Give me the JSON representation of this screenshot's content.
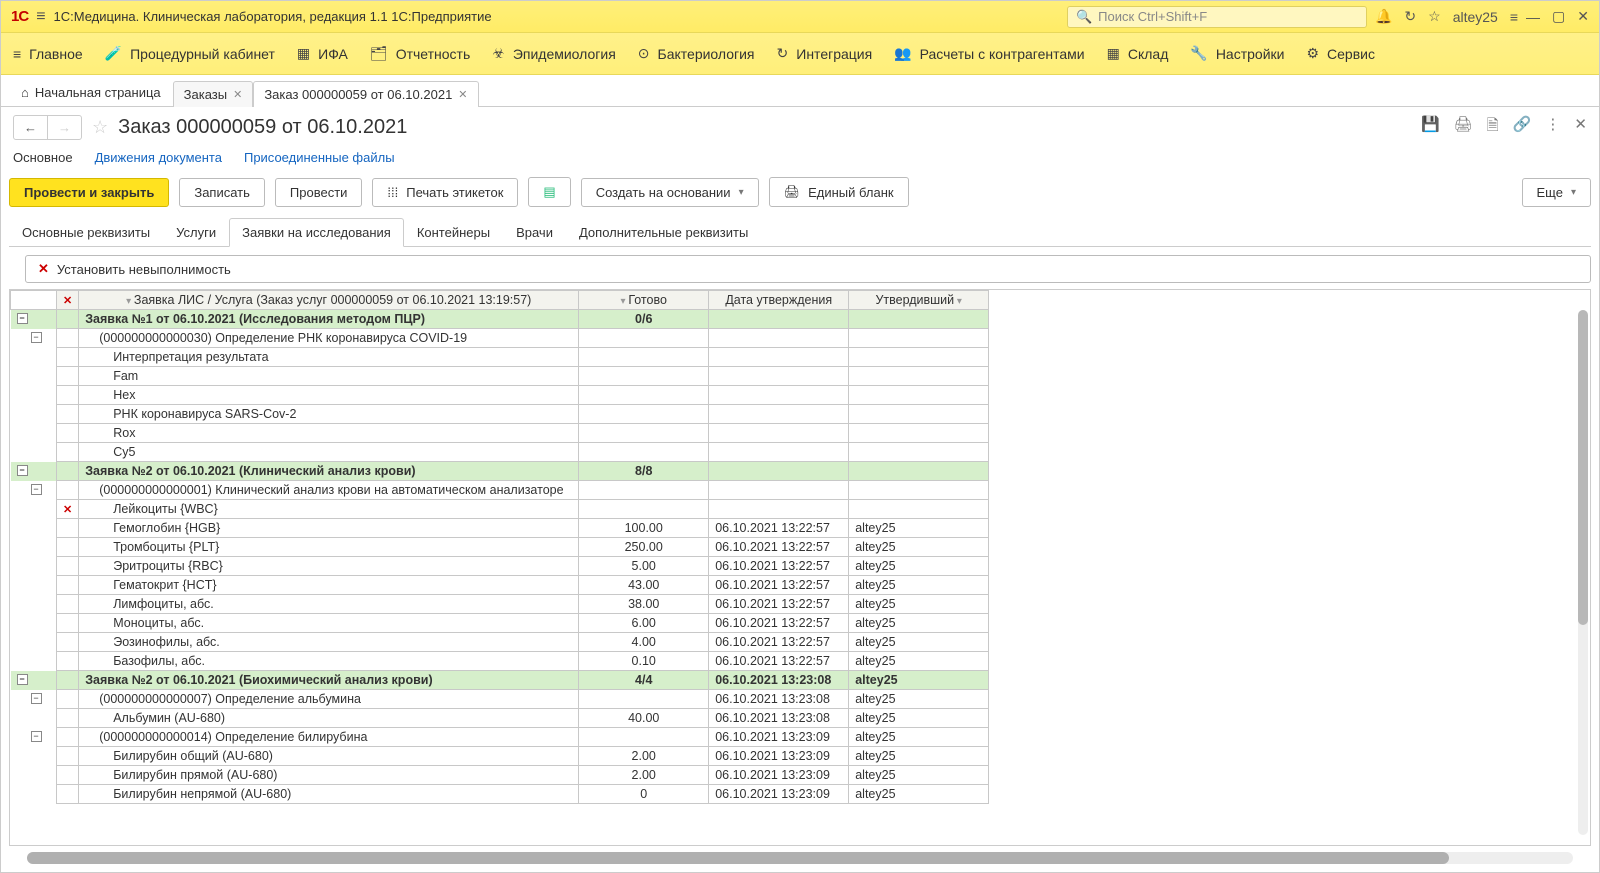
{
  "titlebar": {
    "app_title": "1С:Медицина. Клиническая лаборатория, редакция 1.1 1С:Предприятие",
    "search_placeholder": "Поиск Ctrl+Shift+F",
    "user": "altey25"
  },
  "main_menu": [
    {
      "icon": "≡",
      "label": "Главное"
    },
    {
      "icon": "🧪",
      "label": "Процедурный кабинет"
    },
    {
      "icon": "▦",
      "label": "ИФА"
    },
    {
      "icon": "🗂",
      "label": "Отчетность"
    },
    {
      "icon": "☣",
      "label": "Эпидемиология"
    },
    {
      "icon": "⊙",
      "label": "Бактериология"
    },
    {
      "icon": "↻",
      "label": "Интеграция"
    },
    {
      "icon": "👥",
      "label": "Расчеты с контрагентами"
    },
    {
      "icon": "▦",
      "label": "Склад"
    },
    {
      "icon": "🔧",
      "label": "Настройки"
    },
    {
      "icon": "⚙",
      "label": "Сервис"
    }
  ],
  "tabs": {
    "home": "Начальная страница",
    "open": [
      "Заказы",
      "Заказ 000000059 от 06.10.2021"
    ],
    "active_index": 1
  },
  "page": {
    "title": "Заказ 000000059 от 06.10.2021",
    "sublinks": [
      "Основное",
      "Движения документа",
      "Присоединенные файлы"
    ],
    "active_sublink": 0
  },
  "toolbar": {
    "primary": "Провести и закрыть",
    "save": "Записать",
    "post": "Провести",
    "print_labels": "Печать этикеток",
    "create_based": "Создать на основании",
    "single_form": "Единый бланк",
    "more": "Еще"
  },
  "inner_tabs": [
    "Основные реквизиты",
    "Услуги",
    "Заявки на исследования",
    "Контейнеры",
    "Врачи",
    "Дополнительные реквизиты"
  ],
  "active_inner_tab": 2,
  "sub_toolbar": {
    "set_unperformable": "Установить невыполнимость"
  },
  "grid": {
    "columns": {
      "service": "Заявка ЛИС / Услуга (Заказ услуг 000000059 от 06.10.2021 13:19:57)",
      "ready": "Готово",
      "approve_date": "Дата утверждения",
      "approver": "Утвердивший"
    },
    "rows": [
      {
        "type": "group",
        "service": "Заявка №1 от 06.10.2021 (Исследования методом ПЦР)",
        "ready": "0/6"
      },
      {
        "type": "sub",
        "indent": 1,
        "service": "(000000000000030) Определение РНК коронавируса COVID-19"
      },
      {
        "type": "leaf",
        "indent": 2,
        "service": "Интерпретация результата"
      },
      {
        "type": "leaf",
        "indent": 2,
        "service": "Fam"
      },
      {
        "type": "leaf",
        "indent": 2,
        "service": "Hex"
      },
      {
        "type": "leaf",
        "indent": 2,
        "service": "РНК коронавируса SARS-Cov-2"
      },
      {
        "type": "leaf",
        "indent": 2,
        "service": "Rox"
      },
      {
        "type": "leaf",
        "indent": 2,
        "service": "Cy5"
      },
      {
        "type": "group",
        "service": "Заявка №2 от 06.10.2021 (Клинический анализ крови)",
        "ready": "8/8"
      },
      {
        "type": "sub",
        "indent": 1,
        "service": "(000000000000001) Клинический анализ крови на автоматическом анализаторе"
      },
      {
        "type": "leaf",
        "indent": 2,
        "mark": "x",
        "service": "Лейкоциты {WBC}"
      },
      {
        "type": "leaf",
        "indent": 2,
        "service": "Гемоглобин {HGB}",
        "ready": "100.00",
        "date": "06.10.2021 13:22:57",
        "user": "altey25"
      },
      {
        "type": "leaf",
        "indent": 2,
        "service": "Тромбоциты {PLT}",
        "ready": "250.00",
        "date": "06.10.2021 13:22:57",
        "user": "altey25"
      },
      {
        "type": "leaf",
        "indent": 2,
        "service": "Эритроциты {RBC}",
        "ready": "5.00",
        "date": "06.10.2021 13:22:57",
        "user": "altey25"
      },
      {
        "type": "leaf",
        "indent": 2,
        "service": "Гематокрит {HCT}",
        "ready": "43.00",
        "date": "06.10.2021 13:22:57",
        "user": "altey25"
      },
      {
        "type": "leaf",
        "indent": 2,
        "service": "Лимфоциты, абс.",
        "ready": "38.00",
        "date": "06.10.2021 13:22:57",
        "user": "altey25"
      },
      {
        "type": "leaf",
        "indent": 2,
        "service": "Моноциты, абс.",
        "ready": "6.00",
        "date": "06.10.2021 13:22:57",
        "user": "altey25"
      },
      {
        "type": "leaf",
        "indent": 2,
        "service": "Эозинофилы, абс.",
        "ready": "4.00",
        "date": "06.10.2021 13:22:57",
        "user": "altey25"
      },
      {
        "type": "leaf",
        "indent": 2,
        "service": "Базофилы, абс.",
        "ready": "0.10",
        "date": "06.10.2021 13:22:57",
        "user": "altey25"
      },
      {
        "type": "group",
        "service": "Заявка №2 от 06.10.2021 (Биохимический анализ крови)",
        "ready": "4/4",
        "date": "06.10.2021 13:23:08",
        "user": "altey25"
      },
      {
        "type": "sub",
        "indent": 1,
        "service": "(000000000000007) Определение альбумина",
        "date": "06.10.2021 13:23:08",
        "user": "altey25"
      },
      {
        "type": "leaf",
        "indent": 2,
        "service": "Альбумин (AU-680)",
        "ready": "40.00",
        "date": "06.10.2021 13:23:08",
        "user": "altey25"
      },
      {
        "type": "sub",
        "indent": 1,
        "service": "(000000000000014) Определение билирубина",
        "date": "06.10.2021 13:23:09",
        "user": "altey25"
      },
      {
        "type": "leaf",
        "indent": 2,
        "service": "Билирубин общий (AU-680)",
        "ready": "2.00",
        "date": "06.10.2021 13:23:09",
        "user": "altey25"
      },
      {
        "type": "leaf",
        "indent": 2,
        "service": "Билирубин прямой (AU-680)",
        "ready": "2.00",
        "date": "06.10.2021 13:23:09",
        "user": "altey25"
      },
      {
        "type": "leaf",
        "indent": 2,
        "service": "Билирубин непрямой (AU-680)",
        "ready": "0",
        "date": "06.10.2021 13:23:09",
        "user": "altey25"
      }
    ]
  }
}
